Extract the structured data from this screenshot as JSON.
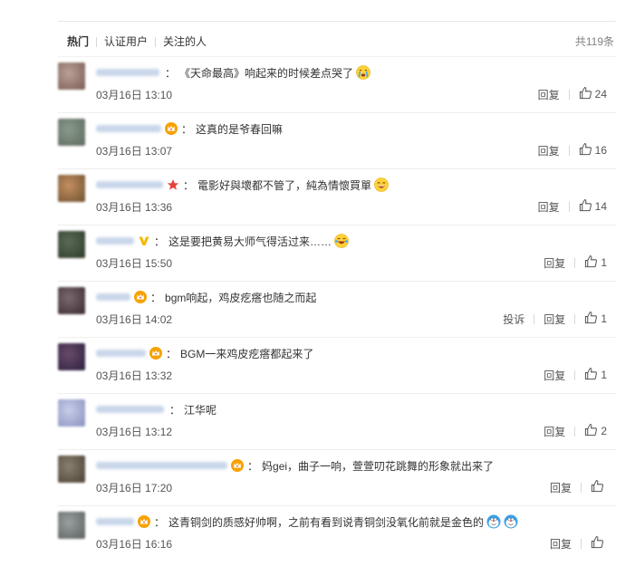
{
  "tabs": [
    "热门",
    "认证用户",
    "关注的人"
  ],
  "total": "共119条",
  "actions": {
    "reply": "回复",
    "report": "投诉"
  },
  "comments": [
    {
      "badge": "none",
      "text": "《天命最高》响起来的时候差点哭了",
      "emoji": "crying-emoji",
      "time": "03月16日 13:10",
      "likes": "24",
      "report": false
    },
    {
      "badge": "crown",
      "text": "这真的是爷春回嘛",
      "emoji": "",
      "time": "03月16日 13:07",
      "likes": "16",
      "report": false
    },
    {
      "badge": "star",
      "text": "電影好與壞都不管了，純為情懷買單",
      "emoji": "laugh-emoji",
      "time": "03月16日 13:36",
      "likes": "14",
      "report": false
    },
    {
      "badge": "verified-v",
      "text": "这是要把黄易大师气得活过来……",
      "emoji": "laugh-cry-emoji",
      "time": "03月16日 15:50",
      "likes": "1",
      "report": false
    },
    {
      "badge": "crown",
      "text": "bgm响起，鸡皮疙瘩也随之而起",
      "emoji": "",
      "time": "03月16日 14:02",
      "likes": "1",
      "report": true
    },
    {
      "badge": "crown",
      "text": "BGM一来鸡皮疙瘩都起来了",
      "emoji": "",
      "time": "03月16日 13:32",
      "likes": "1",
      "report": false
    },
    {
      "badge": "none",
      "text": "江华呢",
      "emoji": "",
      "time": "03月16日 13:12",
      "likes": "2",
      "report": false
    },
    {
      "badge": "crown",
      "text": "妈gei，曲子一响，萱萱叨花跳舞的形象就出来了",
      "emoji": "",
      "time": "03月16日 17:20",
      "likes": "",
      "report": false
    },
    {
      "badge": "crown",
      "text": "这青铜剑的质感好帅啊，之前有看到说青铜剑没氧化前就是金色的",
      "emoji": "doraemon-emoji",
      "time": "03月16日 16:16",
      "likes": "",
      "report": false
    }
  ],
  "colors": {
    "accent": "#f7a200",
    "star": "#e8413b",
    "verified": "#f5b800",
    "border": "#eeeeee"
  }
}
